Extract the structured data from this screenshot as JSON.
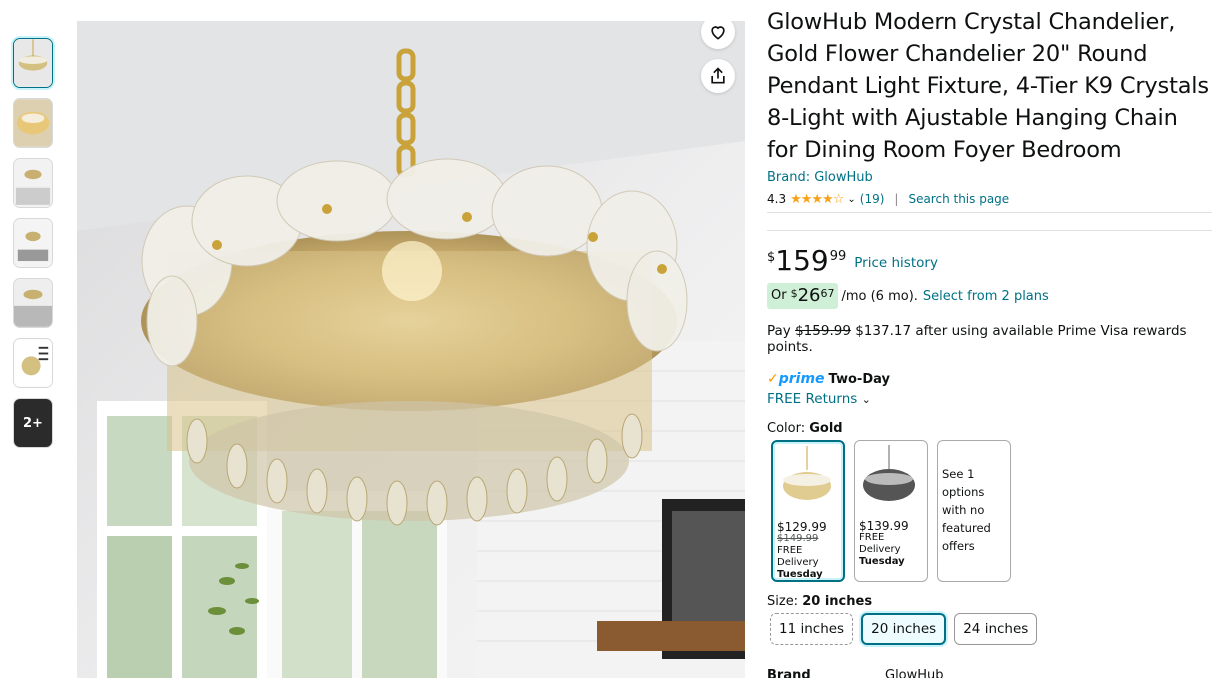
{
  "thumbnails": {
    "more_label": "2+"
  },
  "product": {
    "title": "GlowHub Modern Crystal Chandelier, Gold Flower Chandelier 20\" Round Pendant Light Fixture, 4-Tier K9 Crystals 8-Light with Ajustable Hanging Chain for Dining Room Foyer Bedroom",
    "brand_link": "Brand: GlowHub",
    "rating": "4.3",
    "stars": "★★★★☆",
    "review_count": "(19)",
    "search_page": "Search this page"
  },
  "price": {
    "symbol": "$",
    "whole": "159",
    "fraction": "99",
    "history_link": "Price history"
  },
  "monthly": {
    "prefix": "Or",
    "symbol": "$",
    "whole": "26",
    "fraction": "67",
    "suffix": "/mo (6 mo).",
    "plans_link": "Select from 2 plans"
  },
  "pay": {
    "prefix": "Pay",
    "old": "$159.99",
    "new": "$137.17",
    "suffix": "after using available Prime Visa rewards points."
  },
  "prime": {
    "check": "✓",
    "logo": "prime",
    "label": "Two-Day",
    "returns": "FREE Returns"
  },
  "color": {
    "label": "Color:",
    "value": "Gold",
    "options": [
      {
        "price": "$129.99",
        "old": "$149.99",
        "delivery": "FREE Delivery",
        "day": "Tuesday"
      },
      {
        "price": "$139.99",
        "delivery": "FREE Delivery",
        "day": "Tuesday"
      },
      {
        "text": "See 1 options with no featured offers"
      }
    ]
  },
  "size": {
    "label": "Size:",
    "value": "20 inches",
    "options": [
      "11 inches",
      "20 inches",
      "24 inches"
    ]
  },
  "specs": {
    "label": "Brand",
    "value": "GlowHub"
  },
  "colors": {
    "link": "#007185",
    "star": "#F7A21B",
    "prime_blue": "#1399FF",
    "prime_orange": "#FF9900",
    "badge_green": "#cfefd6"
  }
}
